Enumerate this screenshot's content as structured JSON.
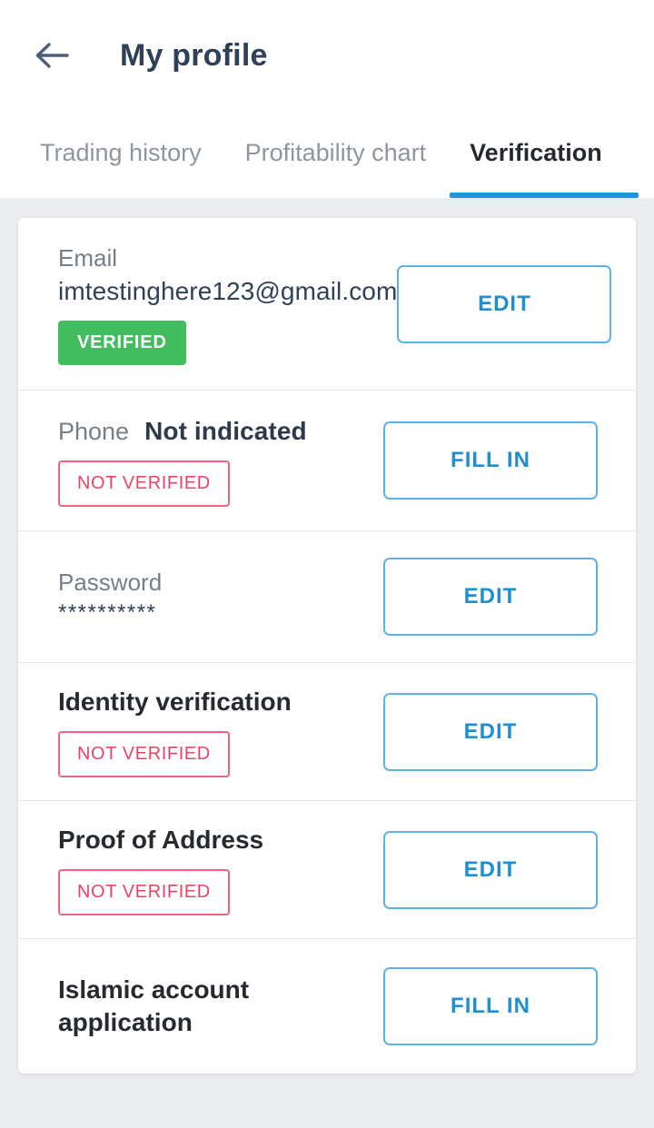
{
  "header": {
    "back_icon": "arrow-left-icon",
    "title": "My profile"
  },
  "tabs": [
    {
      "label": "Trading history",
      "active": false
    },
    {
      "label": "Profitability chart",
      "active": false
    },
    {
      "label": "Verification",
      "active": true
    }
  ],
  "colors": {
    "accent_blue": "#1e8fd2",
    "tab_underline": "#1e95dd",
    "verified_green": "#41bd5f",
    "not_verified_red": "#ef4068",
    "page_background": "#ecedf1",
    "title_dark": "#2f4157",
    "label_gray": "#757f88"
  },
  "rows": {
    "email": {
      "label": "Email",
      "value": "imtestinghere123@gmail.com",
      "badge": "VERIFIED",
      "action": "EDIT"
    },
    "phone": {
      "label": "Phone",
      "value": "Not indicated",
      "badge": "NOT VERIFIED",
      "action": "FILL IN"
    },
    "password": {
      "label": "Password",
      "value": "**********",
      "action": "EDIT"
    },
    "identity": {
      "title": "Identity verification",
      "badge": "NOT VERIFIED",
      "action": "EDIT"
    },
    "address": {
      "title": "Proof of Address",
      "badge": "NOT VERIFIED",
      "action": "EDIT"
    },
    "islamic": {
      "title": "Islamic account application",
      "action": "FILL IN"
    }
  }
}
